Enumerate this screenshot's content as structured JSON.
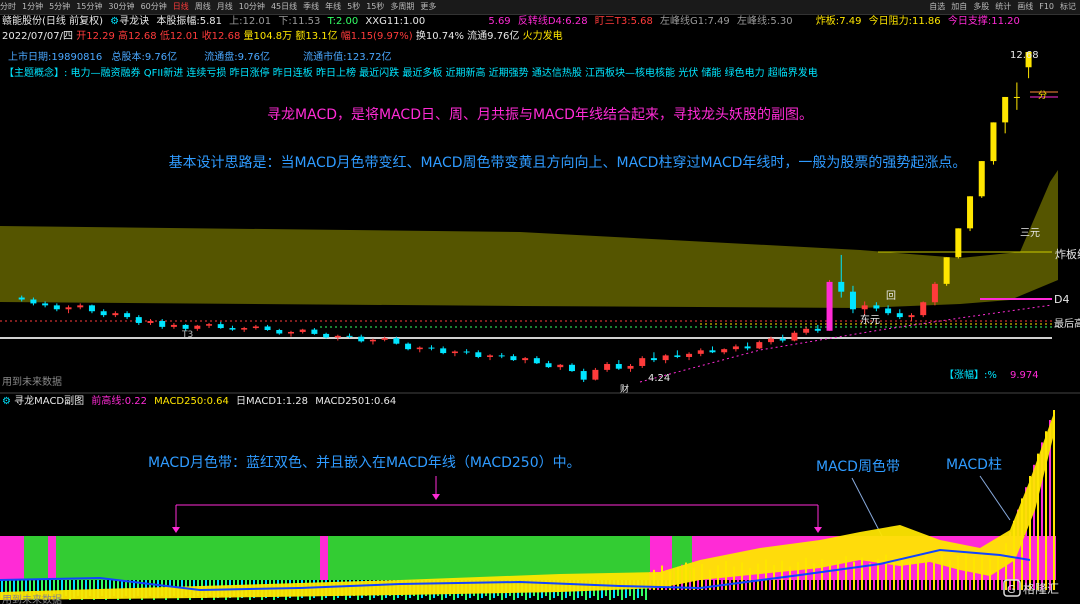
{
  "toolbar": {
    "items": [
      "分时",
      "1分钟",
      "5分钟",
      "15分钟",
      "30分钟",
      "60分钟",
      "日线",
      "周线",
      "月线",
      "10分钟",
      "45日线",
      "季线",
      "年线",
      "5秒",
      "15秒",
      "多周期",
      "更多"
    ],
    "active_index": 6,
    "right": [
      "自选",
      "加自",
      "多股",
      "统计",
      "画线",
      "F10",
      "标记"
    ]
  },
  "header": {
    "name": "赣能股份(日线 前复权)",
    "indicator": "寻龙诀",
    "amp_label": "本股振幅:",
    "amp_value": "5.81",
    "up_label": "上:",
    "up_value": "12.01",
    "down_label": "下:",
    "down_value": "11.53",
    "t_label": "T:",
    "t_value": "2.00",
    "xxg_label": "XXG11:",
    "xxg_value": "1.00",
    "s1_value": "5.69",
    "fz_label": "反转线D4:",
    "fz_value": "6.28",
    "ds_label": "盯三T3:",
    "ds_value": "5.68",
    "zf_label": "左峰线G1:",
    "zf_value": "7.49",
    "zf2_label": "左峰线:",
    "zf2_value": "5.30",
    "zb_label": "炸板:",
    "zb_value": "7.49",
    "zl_label": "今日阻力:",
    "zl_value": "11.86",
    "zc_label": "今日支撑:",
    "zc_value": "11.20"
  },
  "quote": {
    "date": "2022/07/07/四",
    "open": "开12.29",
    "high": "高12.68",
    "low": "低12.01",
    "close": "收12.68",
    "vol": "量104.8万",
    "amount": "额13.1亿",
    "change": "幅1.15(9.97%)",
    "turnover": "换10.74%",
    "float": "流通9.76亿",
    "concept": "火力发电"
  },
  "info": {
    "list_label": "上市日期:",
    "list_value": "19890816",
    "total_label": "总股本:",
    "total_value": "9.76亿",
    "float_label": "流通盘:",
    "float_value": "9.76亿",
    "mv_label": "流通市值:",
    "mv_value": "123.72亿"
  },
  "concepts": "【主题概念】: 电力—融资融券 QFII新进 连续亏损 昨日涨停 昨日连板 昨日上榜 最近闪跌 最近多板 近期新高 近期强势 通达信热股 江西板块—核电核能 光伏 储能 绿色电力 超临界发电",
  "annotations": {
    "line1": "寻龙MACD，是将MACD日、周、月共振与MACD年线结合起来，寻找龙头妖股的副图。",
    "line2": "基本设计思路是：当MACD月色带变红、MACD周色带变黄且方向向上、MACD柱穿过MACD年线时，一般为股票的强势起涨点。",
    "sub_main": "MACD月色带：蓝红双色、并且嵌入在MACD年线（MACD250）中。",
    "weekly": "MACD周色带",
    "bar": "MACD柱"
  },
  "chart_labels": {
    "price_top": "12.68",
    "price_low": "4.24",
    "fen": "分",
    "zhaban": "炸板线",
    "d4": "D4",
    "zuihou": "最后高",
    "sanyuan": "三元",
    "dongyuan": "东元",
    "hui": "回",
    "t3": "T3",
    "rise_label": "【涨幅】:%",
    "rise_value": "9.974",
    "future_data": "用到未来数据",
    "fen2": "财"
  },
  "sub": {
    "title": "寻龙MACD副图",
    "h_label": "前高线:",
    "h_value": "0.22",
    "m250_label": "MACD250:",
    "m250_value": "0.64",
    "d1_label": "日MACD1:",
    "d1_value": "1.28",
    "m2501_label": "MACD2501:",
    "m2501_value": "0.64",
    "future_data": "用到未来数据",
    "brand": "格隆汇"
  },
  "colors": {
    "up": "#ff3b3b",
    "down": "#00e5ff",
    "olive": "#6b6b00",
    "magenta": "#ff2bd6",
    "yellow": "#ffe600",
    "green": "#33cc33"
  },
  "candles": [
    [
      6.4,
      6.45,
      6.3,
      6.35
    ],
    [
      6.35,
      6.4,
      6.2,
      6.25
    ],
    [
      6.25,
      6.3,
      6.15,
      6.2
    ],
    [
      6.2,
      6.25,
      6.05,
      6.1
    ],
    [
      6.1,
      6.2,
      6.0,
      6.15
    ],
    [
      6.15,
      6.25,
      6.1,
      6.2
    ],
    [
      6.2,
      6.22,
      6.0,
      6.05
    ],
    [
      6.05,
      6.1,
      5.9,
      5.95
    ],
    [
      5.95,
      6.05,
      5.9,
      6.0
    ],
    [
      6.0,
      6.05,
      5.85,
      5.9
    ],
    [
      5.9,
      5.95,
      5.7,
      5.75
    ],
    [
      5.75,
      5.85,
      5.7,
      5.8
    ],
    [
      5.8,
      5.85,
      5.6,
      5.65
    ],
    [
      5.65,
      5.75,
      5.6,
      5.7
    ],
    [
      5.7,
      5.72,
      5.55,
      5.6
    ],
    [
      5.6,
      5.7,
      5.55,
      5.68
    ],
    [
      5.68,
      5.75,
      5.62,
      5.72
    ],
    [
      5.72,
      5.78,
      5.6,
      5.62
    ],
    [
      5.62,
      5.68,
      5.55,
      5.58
    ],
    [
      5.58,
      5.65,
      5.52,
      5.62
    ],
    [
      5.62,
      5.7,
      5.58,
      5.66
    ],
    [
      5.66,
      5.7,
      5.55,
      5.57
    ],
    [
      5.57,
      5.6,
      5.45,
      5.48
    ],
    [
      5.48,
      5.55,
      5.4,
      5.52
    ],
    [
      5.52,
      5.6,
      5.48,
      5.58
    ],
    [
      5.58,
      5.62,
      5.45,
      5.47
    ],
    [
      5.47,
      5.5,
      5.35,
      5.38
    ],
    [
      5.38,
      5.45,
      5.3,
      5.42
    ],
    [
      5.42,
      5.48,
      5.36,
      5.4
    ],
    [
      5.4,
      5.45,
      5.25,
      5.28
    ],
    [
      5.28,
      5.35,
      5.2,
      5.32
    ],
    [
      5.32,
      5.4,
      5.28,
      5.36
    ],
    [
      5.36,
      5.4,
      5.2,
      5.22
    ],
    [
      5.22,
      5.25,
      5.05,
      5.08
    ],
    [
      5.08,
      5.15,
      5.0,
      5.12
    ],
    [
      5.12,
      5.18,
      5.05,
      5.1
    ],
    [
      5.1,
      5.15,
      4.95,
      4.98
    ],
    [
      4.98,
      5.05,
      4.9,
      5.02
    ],
    [
      5.02,
      5.08,
      4.95,
      5.0
    ],
    [
      5.0,
      5.05,
      4.85,
      4.88
    ],
    [
      4.88,
      4.95,
      4.8,
      4.92
    ],
    [
      4.92,
      4.98,
      4.85,
      4.9
    ],
    [
      4.9,
      4.95,
      4.78,
      4.8
    ],
    [
      4.8,
      4.88,
      4.72,
      4.85
    ],
    [
      4.85,
      4.9,
      4.7,
      4.72
    ],
    [
      4.72,
      4.78,
      4.6,
      4.62
    ],
    [
      4.62,
      4.7,
      4.55,
      4.68
    ],
    [
      4.68,
      4.72,
      4.5,
      4.52
    ],
    [
      4.52,
      4.58,
      4.24,
      4.3
    ],
    [
      4.3,
      4.6,
      4.28,
      4.55
    ],
    [
      4.55,
      4.75,
      4.5,
      4.7
    ],
    [
      4.7,
      4.8,
      4.55,
      4.58
    ],
    [
      4.58,
      4.7,
      4.5,
      4.65
    ],
    [
      4.65,
      4.9,
      4.6,
      4.85
    ],
    [
      4.85,
      5.0,
      4.75,
      4.8
    ],
    [
      4.8,
      4.95,
      4.72,
      4.92
    ],
    [
      4.92,
      5.05,
      4.85,
      4.88
    ],
    [
      4.88,
      5.0,
      4.8,
      4.96
    ],
    [
      4.96,
      5.1,
      4.9,
      5.05
    ],
    [
      5.05,
      5.15,
      4.98,
      5.0
    ],
    [
      5.0,
      5.1,
      4.95,
      5.08
    ],
    [
      5.08,
      5.2,
      5.02,
      5.15
    ],
    [
      5.15,
      5.25,
      5.05,
      5.1
    ],
    [
      5.1,
      5.3,
      5.08,
      5.26
    ],
    [
      5.26,
      5.4,
      5.2,
      5.35
    ],
    [
      5.35,
      5.45,
      5.25,
      5.3
    ],
    [
      5.3,
      5.55,
      5.28,
      5.5
    ],
    [
      5.5,
      5.65,
      5.45,
      5.6
    ],
    [
      5.6,
      5.7,
      5.5,
      5.55
    ],
    [
      5.55,
      6.85,
      5.55,
      6.8
    ],
    [
      6.8,
      7.49,
      6.4,
      6.55
    ],
    [
      6.55,
      6.7,
      6.0,
      6.1
    ],
    [
      6.1,
      6.3,
      5.95,
      6.2
    ],
    [
      6.2,
      6.28,
      6.05,
      6.12
    ],
    [
      6.12,
      6.2,
      5.95,
      6.0
    ],
    [
      6.0,
      6.1,
      5.85,
      5.9
    ],
    [
      5.9,
      6.0,
      5.8,
      5.95
    ],
    [
      5.95,
      6.3,
      5.9,
      6.28
    ],
    [
      6.28,
      6.8,
      6.2,
      6.75
    ],
    [
      6.75,
      7.43,
      6.7,
      7.43
    ],
    [
      7.43,
      8.17,
      7.4,
      8.17
    ],
    [
      8.17,
      8.99,
      8.1,
      8.99
    ],
    [
      8.99,
      9.89,
      8.95,
      9.89
    ],
    [
      9.89,
      10.88,
      9.8,
      10.88
    ],
    [
      10.88,
      11.53,
      10.6,
      11.53
    ],
    [
      11.53,
      11.9,
      11.2,
      11.53
    ],
    [
      12.29,
      12.68,
      12.01,
      12.68
    ]
  ]
}
